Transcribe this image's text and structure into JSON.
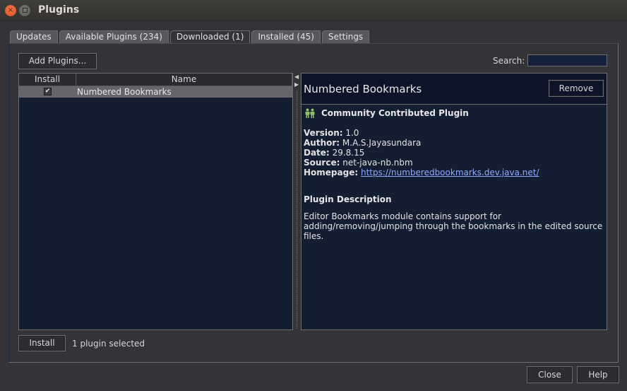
{
  "window": {
    "title": "Plugins",
    "close_glyph": "×"
  },
  "tabs": [
    {
      "label": "Updates",
      "active": false
    },
    {
      "label": "Available Plugins (234)",
      "active": false
    },
    {
      "label": "Downloaded (1)",
      "active": true
    },
    {
      "label": "Installed (45)",
      "active": false
    },
    {
      "label": "Settings",
      "active": false
    }
  ],
  "toolbar": {
    "add_plugins_label": "Add Plugins...",
    "search_label": "Search:",
    "search_value": ""
  },
  "table": {
    "columns": [
      "Install",
      "Name"
    ],
    "rows": [
      {
        "install": true,
        "check_glyph": "✔",
        "name": "Numbered Bookmarks",
        "selected": true
      }
    ]
  },
  "splitter": {
    "left_arrow": "◀",
    "right_arrow": "▶"
  },
  "details": {
    "title": "Numbered Bookmarks",
    "remove_label": "Remove",
    "badge": "Community Contributed Plugin",
    "fields": [
      {
        "label": "Version:",
        "value": "1.0"
      },
      {
        "label": "Author:",
        "value": "M.A.S.Jayasundara"
      },
      {
        "label": "Date:",
        "value": "29.8.15"
      },
      {
        "label": "Source:",
        "value": "net-java-nb.nbm"
      },
      {
        "label": "Homepage:",
        "value": "https://numberedbookmarks.dev.java.net/"
      }
    ],
    "description_title": "Plugin Description",
    "description": "Editor Bookmarks module contains support for adding/removing/jumping through the bookmarks in the edited source files."
  },
  "footer": {
    "install_label": "Install",
    "status": "1 plugin selected",
    "close_label": "Close",
    "help_label": "Help"
  },
  "colors": {
    "link": "#8fa8ff",
    "community_icon": "#8fbf6a"
  }
}
